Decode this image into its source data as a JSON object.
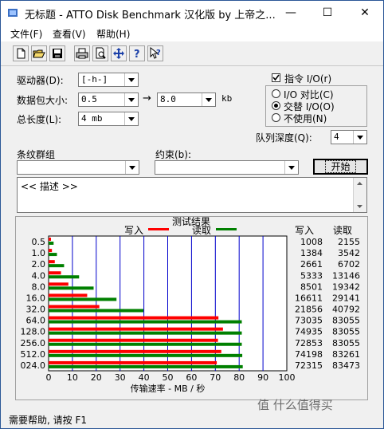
{
  "window": {
    "title": "无标题 - ATTO Disk Benchmark  汉化版 by 上帝之...",
    "minimize_glyph": "—",
    "maximize_glyph": "☐",
    "close_glyph": "✕"
  },
  "menu": [
    {
      "label": "文件(F)"
    },
    {
      "label": "查看(V)"
    },
    {
      "label": "帮助(H)"
    }
  ],
  "toolbar": [
    "new-icon",
    "open-icon",
    "save-icon",
    "print-icon",
    "print-preview-icon",
    "move-icon",
    "help-icon",
    "context-help-icon"
  ],
  "settings": {
    "drive_label": "驱动器(D):",
    "drive_value": "[-h-]",
    "packet_label": "数据包大小:",
    "packet_from": "0.5",
    "arrow": "→",
    "packet_to": "8.0",
    "packet_unit": "kb",
    "total_label": "总长度(L):",
    "total_value": "4 mb",
    "direct_io_label": "指令 I/O(r)",
    "io_compare_label": "I/O 对比(C)",
    "overlap_io_label": "交替 I/O(O)",
    "neither_label": "不使用(N)",
    "queue_label": "队列深度(Q):",
    "queue_value": "4",
    "stripe_label": "条纹群组",
    "constraint_label": "约束(b):",
    "start_button": "开始",
    "desc_text": "<< 描述 >>"
  },
  "chart_data": {
    "type": "bar",
    "title": "测试结果",
    "legend_write": "写入",
    "legend_read": "读取",
    "col_write": "写入",
    "col_read": "读取",
    "xlabel": "传输速率 - MB / 秒",
    "x_ticks": [
      "0",
      "10",
      "20",
      "30",
      "40",
      "50",
      "60",
      "70",
      "80",
      "90",
      "100"
    ],
    "xlim": [
      0,
      100
    ],
    "categories": [
      "0.5",
      "1.0",
      "2.0",
      "4.0",
      "8.0",
      "16.0",
      "32.0",
      "64.0",
      "128.0",
      "256.0",
      "512.0",
      "024.0"
    ],
    "write_kb": [
      "1008",
      "1384",
      "2661",
      "5333",
      "8501",
      "16611",
      "21856",
      "73035",
      "74935",
      "72853",
      "74198",
      "72315"
    ],
    "read_kb": [
      "2155",
      "3542",
      "6702",
      "13146",
      "19342",
      "29141",
      "40792",
      "83055",
      "83055",
      "83055",
      "83261",
      "83473"
    ],
    "series": [
      {
        "name": "写入",
        "color": "#ff0000",
        "values": [
          1.0,
          1.4,
          2.6,
          5.2,
          8.3,
          16.2,
          21.3,
          71.3,
          73.2,
          71.1,
          72.5,
          70.6
        ]
      },
      {
        "name": "读取",
        "color": "#008000",
        "values": [
          2.1,
          3.5,
          6.5,
          12.8,
          18.9,
          28.5,
          39.8,
          81.1,
          81.1,
          81.1,
          81.3,
          81.5
        ]
      }
    ],
    "grid_color": "#0000cc",
    "legend_position": "top"
  },
  "status": {
    "text": "需要帮助, 请按 F1"
  },
  "watermark": "值 什么值得买"
}
